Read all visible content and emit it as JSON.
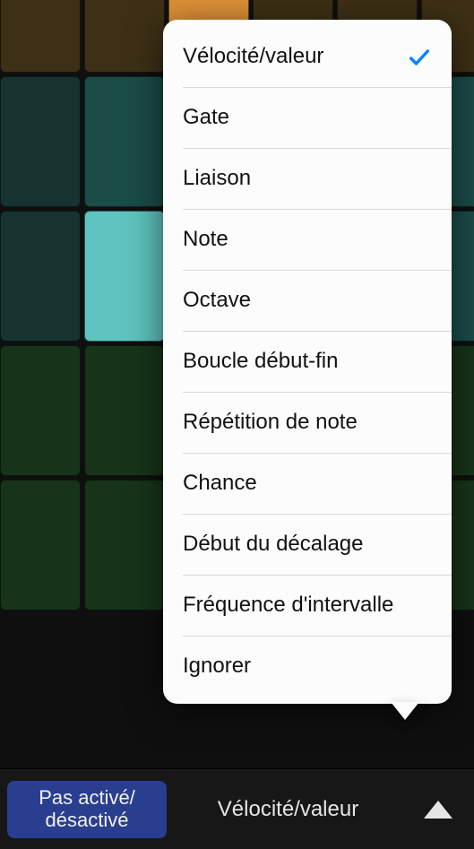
{
  "grid": {
    "rows": [
      {
        "cells": [
          "#3e3016",
          "#3e3016",
          "#de9137",
          "#3e3016",
          "#3e3016",
          "#3e3016"
        ]
      },
      {
        "cells": [
          "#16332f",
          "#1b4c48",
          "#1b4c48",
          "#1b4c48",
          "#1b4c48",
          "#1b4c48"
        ]
      },
      {
        "cells": [
          "#16332f",
          "#5fc4bf",
          "#1b4c48",
          "#1b4c48",
          "#1b4c48",
          "#1b4c48"
        ]
      },
      {
        "cells": [
          "#17341a",
          "#17341a",
          "#48b956",
          "#17341a",
          "#17341a",
          "#17341a"
        ]
      },
      {
        "cells": [
          "#17341a",
          "#17341a",
          "#1d4a22",
          "#17341a",
          "#17341a",
          "#17341a"
        ]
      }
    ]
  },
  "popover": {
    "items": [
      {
        "label": "Vélocité/valeur",
        "selected": true
      },
      {
        "label": "Gate",
        "selected": false
      },
      {
        "label": "Liaison",
        "selected": false
      },
      {
        "label": "Note",
        "selected": false
      },
      {
        "label": "Octave",
        "selected": false
      },
      {
        "label": "Boucle début-fin",
        "selected": false
      },
      {
        "label": "Répétition de note",
        "selected": false
      },
      {
        "label": "Chance",
        "selected": false
      },
      {
        "label": "Début du décalage",
        "selected": false
      },
      {
        "label": "Fréquence d'intervalle",
        "selected": false
      },
      {
        "label": "Ignorer",
        "selected": false
      }
    ]
  },
  "toolbar": {
    "toggle_label": "Pas activé/\ndésactivé",
    "mode_label": "Vélocité/valeur"
  },
  "colors": {
    "accent": "#0a84ff",
    "button_primary": "#2a3e8f"
  }
}
